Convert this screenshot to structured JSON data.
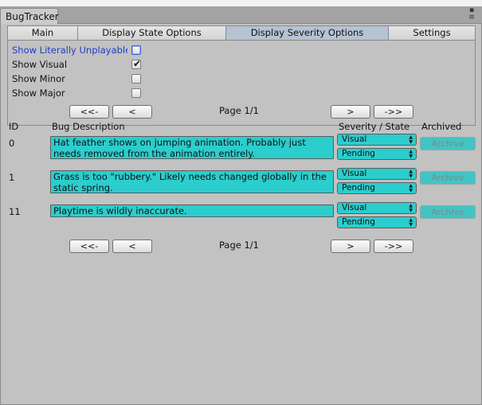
{
  "window": {
    "title": "BugTracker",
    "buttons": [
      "▪",
      "≡"
    ]
  },
  "tabs": [
    {
      "label": "Main",
      "active": false
    },
    {
      "label": "Display State Options",
      "active": false
    },
    {
      "label": "Display Severity Options",
      "active": true
    },
    {
      "label": "Settings",
      "active": false
    }
  ],
  "options": [
    {
      "label": "Show Literally Unplayable",
      "checked": false,
      "focused": true
    },
    {
      "label": "Show Visual",
      "checked": true,
      "focused": false
    },
    {
      "label": "Show Minor",
      "checked": false,
      "focused": false
    },
    {
      "label": "Show Major",
      "checked": false,
      "focused": false
    }
  ],
  "pagination": {
    "first": "<<-",
    "prev": "<",
    "next": ">",
    "last": "->>",
    "label": "Page 1/1"
  },
  "columns": {
    "id": "ID",
    "description": "Bug Description",
    "severity_state": "Severity / State",
    "archived": "Archived"
  },
  "bugs": [
    {
      "id": "0",
      "description": "Hat feather shows on jumping animation. Probably just needs removed from the animation entirely.",
      "severity": "Visual",
      "state": "Pending",
      "archive_label": "Archive"
    },
    {
      "id": "1",
      "description": "Grass is too \"rubbery.\" Likely needs changed globally in the static spring.",
      "severity": "Visual",
      "state": "Pending",
      "archive_label": "Archive"
    },
    {
      "id": "11",
      "description": "Playtime is wildly inaccurate.",
      "severity": "Visual",
      "state": "Pending",
      "archive_label": "Archive"
    }
  ],
  "colors": {
    "accent": "#2ccdcd",
    "active_tab": "#b5c3d3",
    "background": "#c2c2c2"
  },
  "icons": {
    "checked": "✔",
    "dropdown": "dropdown-arrow-icon"
  }
}
